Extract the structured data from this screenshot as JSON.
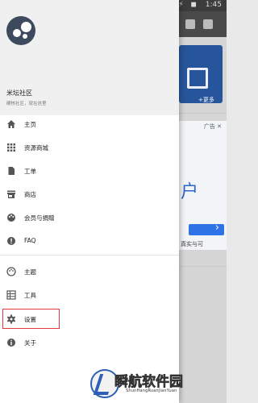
{
  "status_bar": {
    "time": "1:45",
    "icons": "▲ ⚡ ◼"
  },
  "drawer": {
    "app_name": "米坛社区",
    "tagline": "硬核社区，就在这里",
    "items": [
      {
        "label": "主页",
        "icon": "home-icon"
      },
      {
        "label": "资源商城",
        "icon": "grid-icon"
      },
      {
        "label": "工单",
        "icon": "file-icon"
      },
      {
        "label": "商店",
        "icon": "store-icon"
      },
      {
        "label": "会员与捐赠",
        "icon": "palette-icon"
      },
      {
        "label": "FAQ",
        "icon": "info-icon"
      },
      {
        "label": "主题",
        "icon": "theme-icon"
      },
      {
        "label": "工具",
        "icon": "table-icon"
      },
      {
        "label": "设置",
        "icon": "gear-icon"
      },
      {
        "label": "关于",
        "icon": "about-icon"
      }
    ],
    "highlighted_item": "设置"
  },
  "background": {
    "more_label": "+更多",
    "ad_label": "广告 ✕",
    "ad_big_text": "户",
    "ad_footer": "真实与可"
  },
  "watermark": {
    "title": "瞬航软件园",
    "subtitle": "ShunHangRuanJianYuan"
  },
  "colors": {
    "highlight": "#e03a3a",
    "icon": "#555555",
    "watermark_blue": "#2d5fb8"
  }
}
